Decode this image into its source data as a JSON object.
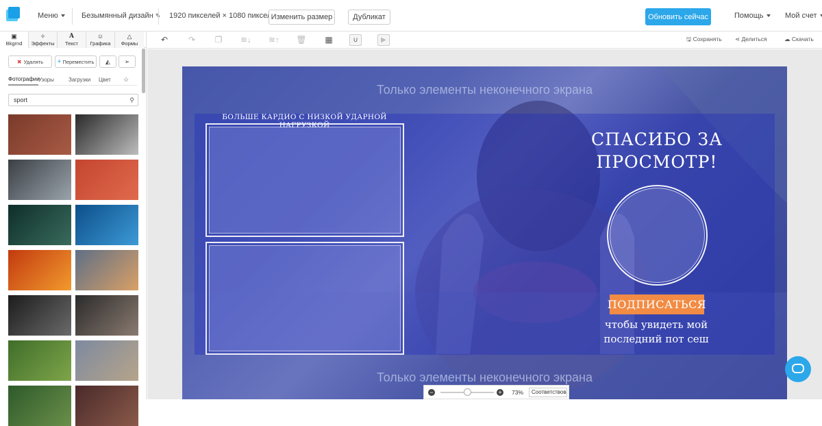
{
  "header": {
    "menu_label": "Меню",
    "design_name": "Безымянный дизайн",
    "dimensions": "1920 пикселей × 1080 пикселей",
    "resize_label": "Изменить размер",
    "duplicate_label": "Дубликат",
    "upgrade_label": "Обновить сейчас",
    "help_label": "Помощь",
    "account_label": "Мой счет"
  },
  "sidebar": {
    "tabs": [
      {
        "label": "Bkgrnd",
        "icon": "image-icon"
      },
      {
        "label": "Эффекты",
        "icon": "wand-icon"
      },
      {
        "label": "Текст",
        "icon": "text-icon"
      },
      {
        "label": "Графика",
        "icon": "smile-icon"
      },
      {
        "label": "Формы",
        "icon": "triangle-icon"
      }
    ],
    "delete_label": "Удалять",
    "move_label": "Переместить",
    "subtabs": [
      "Фотографии",
      "Узоры",
      "Загрузки",
      "Цвет"
    ],
    "search_value": "sport",
    "thumbs": [
      {
        "name": "thumb-running-track-feet",
        "c1": "#7a3a2a",
        "c2": "#a85b45"
      },
      {
        "name": "thumb-boxers-bw",
        "c1": "#2a2a2a",
        "c2": "#bdbdbd"
      },
      {
        "name": "thumb-bridge-runner",
        "c1": "#3b3f45",
        "c2": "#9aa3ab"
      },
      {
        "name": "thumb-red-track-lanes",
        "c1": "#c4452f",
        "c2": "#e06a4d"
      },
      {
        "name": "thumb-dark-gym-woman",
        "c1": "#0e2e2a",
        "c2": "#3a6b5c"
      },
      {
        "name": "thumb-swimmer",
        "c1": "#0d4f8a",
        "c2": "#3c9ad6"
      },
      {
        "name": "thumb-sunset-runners",
        "c1": "#c23a0f",
        "c2": "#f29a2d"
      },
      {
        "name": "thumb-rock-climber",
        "c1": "#5f6f86",
        "c2": "#d9a066"
      },
      {
        "name": "thumb-bodybuilder",
        "c1": "#1c1c1c",
        "c2": "#6a6a6a"
      },
      {
        "name": "thumb-weightlifter",
        "c1": "#2b2b2b",
        "c2": "#8a7a70"
      },
      {
        "name": "thumb-cyclists",
        "c1": "#3f6e2a",
        "c2": "#7fa54a"
      },
      {
        "name": "thumb-mountain-biker",
        "c1": "#7d8aa0",
        "c2": "#b7a48a"
      },
      {
        "name": "thumb-bottom-left",
        "c1": "#2d5a2a",
        "c2": "#6b8f4a"
      },
      {
        "name": "thumb-bottom-right",
        "c1": "#4a2a2a",
        "c2": "#8a5a4a"
      }
    ]
  },
  "toolbar": {
    "save_label": "Сохранять",
    "share_label": "Делиться",
    "download_label": "Скачать"
  },
  "design": {
    "ghost_top": "Только элементы неконечного экрана",
    "ghost_bottom": "Только элементы неконечного экрана",
    "cardio_title": "БОЛЬШЕ КАРДИО С НИЗКОЙ УДАРНОЙ НАГРУЗКОЙ",
    "thanks_title": "СПАСИБО ЗА ПРОСМОТР!",
    "subscribe_label": "ПОДПИСАТЬСЯ",
    "cta_text": "чтобы увидеть мой последний пот сеш"
  },
  "zoom": {
    "percent": "73%",
    "fit_label": "Соответствовать",
    "level": 0.5
  },
  "colors": {
    "accent": "#2ba7ea",
    "overlay": "#2634aa",
    "subscribe": "#f28b44"
  }
}
